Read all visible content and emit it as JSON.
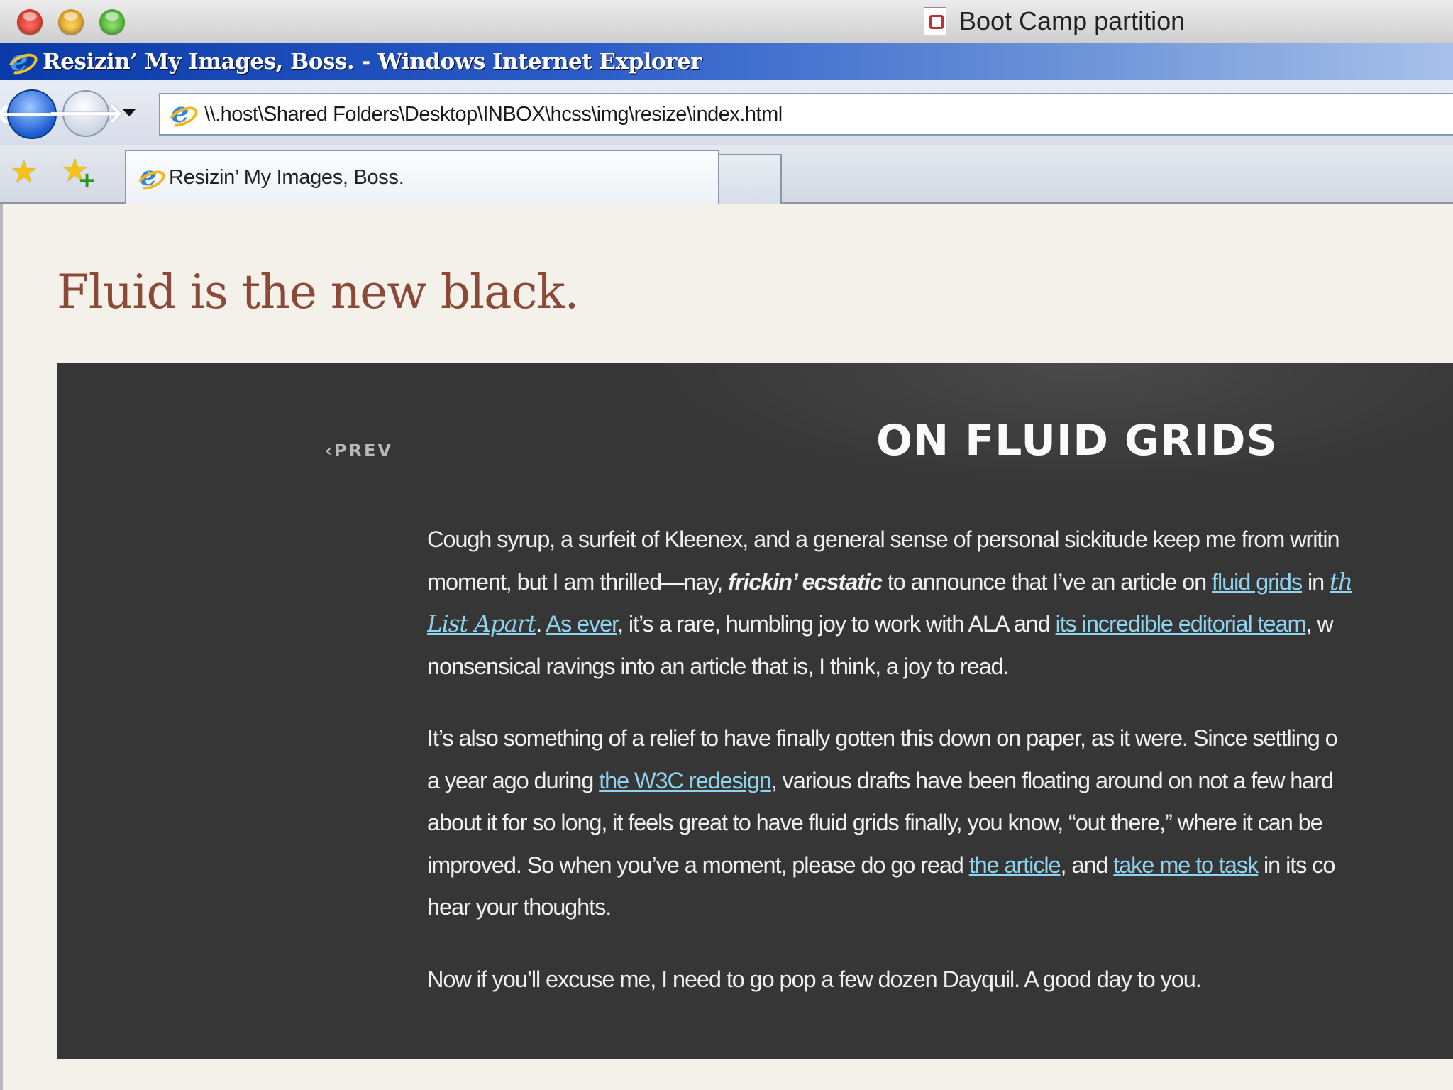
{
  "mac_window": {
    "title": "Boot Camp partition"
  },
  "ie_window": {
    "title": "Resizin’ My Images, Boss. - Windows Internet Explorer"
  },
  "navigation": {
    "back_glyph": "🡐",
    "forward_glyph": "🡒",
    "address": "\\\\.host\\Shared Folders\\Desktop\\INBOX\\hcss\\img\\resize\\index.html"
  },
  "favorites": {
    "star_glyph": "★",
    "add_plus_glyph": "+"
  },
  "tab": {
    "label": "Resizin’ My Images, Boss."
  },
  "page": {
    "title": "Fluid is the new black.",
    "prev_label": "‹PREV",
    "article_title": "ON FLUID GRIDS",
    "p1": {
      "t1": "Cough syrup, a surfeit of Kleenex, and a general sense of personal sickitude keep me from writin",
      "t2": "moment, but I am thrilled—nay, ",
      "em1": "frickin’ ecstatic",
      "t3": " to announce that I’ve an article on ",
      "link_fluid_grids": "fluid grids",
      "t4": " in ",
      "link_ala_part1": "th",
      "link_ala_part2": "List Apart",
      "t5": ". ",
      "link_as_ever": "As ever",
      "t6": ", it’s a rare, humbling joy to work with ALA and ",
      "link_editorial": "its incredible editorial team",
      "t7": ", w",
      "t8": "nonsensical ravings into an article that is, I think, a joy to read."
    },
    "p2": {
      "t1": "It’s also something of a relief to have finally gotten this down on paper, as it were. Since settling o",
      "t2": "a year ago during ",
      "link_w3c": "the W3C redesign",
      "t3": ", various drafts have been floating around on not a few hard",
      "t4": "about it for so long, it feels great to have fluid grids finally, you know, “out there,” where it can be",
      "t5": "improved. So when you’ve a moment, please do go read ",
      "link_article": "the article",
      "t6": ", and ",
      "link_task": "take me to task",
      "t7": " in its co",
      "t8": "hear your thoughts."
    },
    "p3": "Now if you’ll excuse me, I need to go pop a few dozen Dayquil. A good day to you."
  }
}
